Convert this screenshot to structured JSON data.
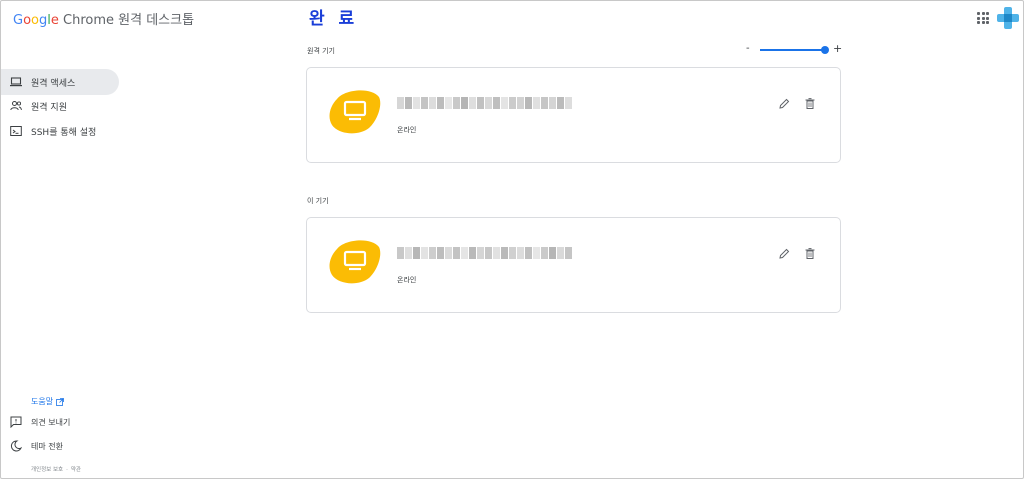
{
  "app": {
    "logo_g": "G",
    "logo_o1": "o",
    "logo_o2": "o",
    "logo_g2": "g",
    "logo_l": "l",
    "logo_e": "e",
    "logo_rest": " Chrome 원격 데스크톱",
    "done_label": "완 료"
  },
  "sidebar": {
    "items": [
      {
        "label": "원격 액세스",
        "icon": "laptop-icon",
        "active": true
      },
      {
        "label": "원격 지원",
        "icon": "people-icon",
        "active": false
      },
      {
        "label": "SSH를 통해 설정",
        "icon": "terminal-icon",
        "active": false
      }
    ],
    "help": "도움말",
    "feedback": "의견 보내기",
    "theme": "테마 전환",
    "privacy": "개인정보 보호",
    "separator": "·",
    "terms": "약관"
  },
  "main": {
    "remote_section_label": "원격 기기",
    "this_section_label": "이 기기",
    "zoom": {
      "minus": "-",
      "plus": "+",
      "level": 0.92
    },
    "devices": [
      {
        "status": "온라인",
        "name_blurred": true
      },
      {
        "status": "온라인",
        "name_blurred": true
      }
    ]
  },
  "colors": {
    "accent": "#1a73e8",
    "device_blob": "#fbbc04",
    "active_nav": "#e8eaed"
  }
}
